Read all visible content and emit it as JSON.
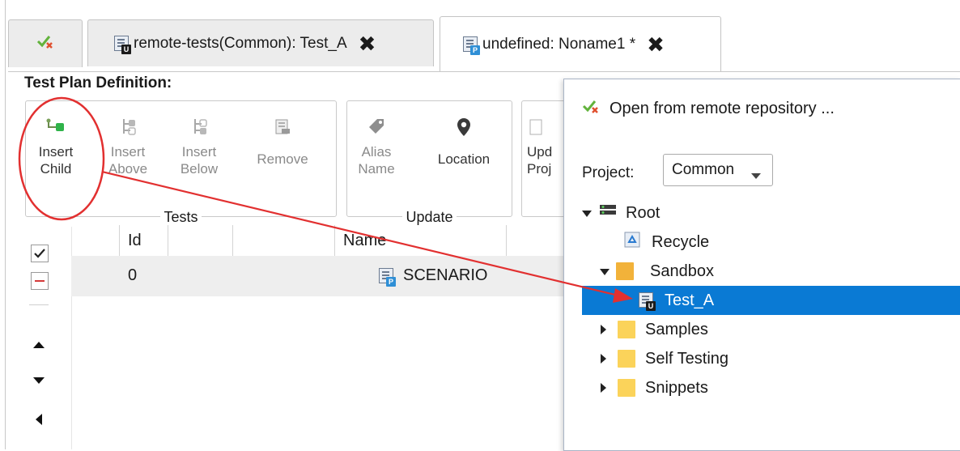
{
  "tabs": [
    {
      "label": "",
      "icon": "connect-check-icon"
    },
    {
      "label": "remote-tests(Common): Test_A",
      "icon": "test-doc-u-icon",
      "close": "✖"
    },
    {
      "label": "undefined: Noname1 *",
      "icon": "test-plan-p-icon",
      "close": "✖"
    }
  ],
  "editor": {
    "section_title": "Test Plan Definition:",
    "groups": {
      "tests": {
        "label": "Tests",
        "buttons": [
          {
            "line1": "Insert",
            "line2": "Child",
            "icon": "insert-child-icon",
            "enabled": true
          },
          {
            "line1": "Insert",
            "line2": "Above",
            "icon": "insert-above-icon",
            "enabled": false
          },
          {
            "line1": "Insert",
            "line2": "Below",
            "icon": "insert-below-icon",
            "enabled": false
          },
          {
            "line1": "Remove",
            "line2": "",
            "icon": "remove-icon",
            "enabled": false
          }
        ]
      },
      "update": {
        "label": "Update",
        "buttons": [
          {
            "line1": "Alias",
            "line2": "Name",
            "icon": "tag-icon",
            "enabled": false
          },
          {
            "line1": "Location",
            "line2": "",
            "icon": "location-pin-icon",
            "enabled": true
          }
        ]
      },
      "partial": {
        "line1": "Upd",
        "line2": "Proj"
      }
    },
    "grid": {
      "columns": [
        "Id",
        "",
        "Name"
      ],
      "rows": [
        {
          "id": "0",
          "name": "SCENARIO"
        }
      ]
    }
  },
  "dialog": {
    "title": "Open from remote repository ...",
    "project_label": "Project:",
    "project_value": "Common",
    "tree": [
      {
        "label": "Root",
        "icon": "server-icon",
        "expanded": true
      },
      {
        "label": "Recycle",
        "icon": "recycle-icon"
      },
      {
        "label": "Sandbox",
        "icon": "folder-icon",
        "expanded": true
      },
      {
        "label": "Test_A",
        "icon": "test-doc-u-icon",
        "selected": true
      },
      {
        "label": "Samples",
        "icon": "folder-icon",
        "expanded": false
      },
      {
        "label": "Self Testing",
        "icon": "folder-icon",
        "expanded": false
      },
      {
        "label": "Snippets",
        "icon": "folder-icon",
        "expanded": false
      }
    ]
  },
  "colors": {
    "selection": "#0a7ad4",
    "annotation_red": "#e23030",
    "folder_yellow": "#fbd35a",
    "sandbox_orange": "#f2b23a",
    "green_badge": "#3aa53a"
  }
}
